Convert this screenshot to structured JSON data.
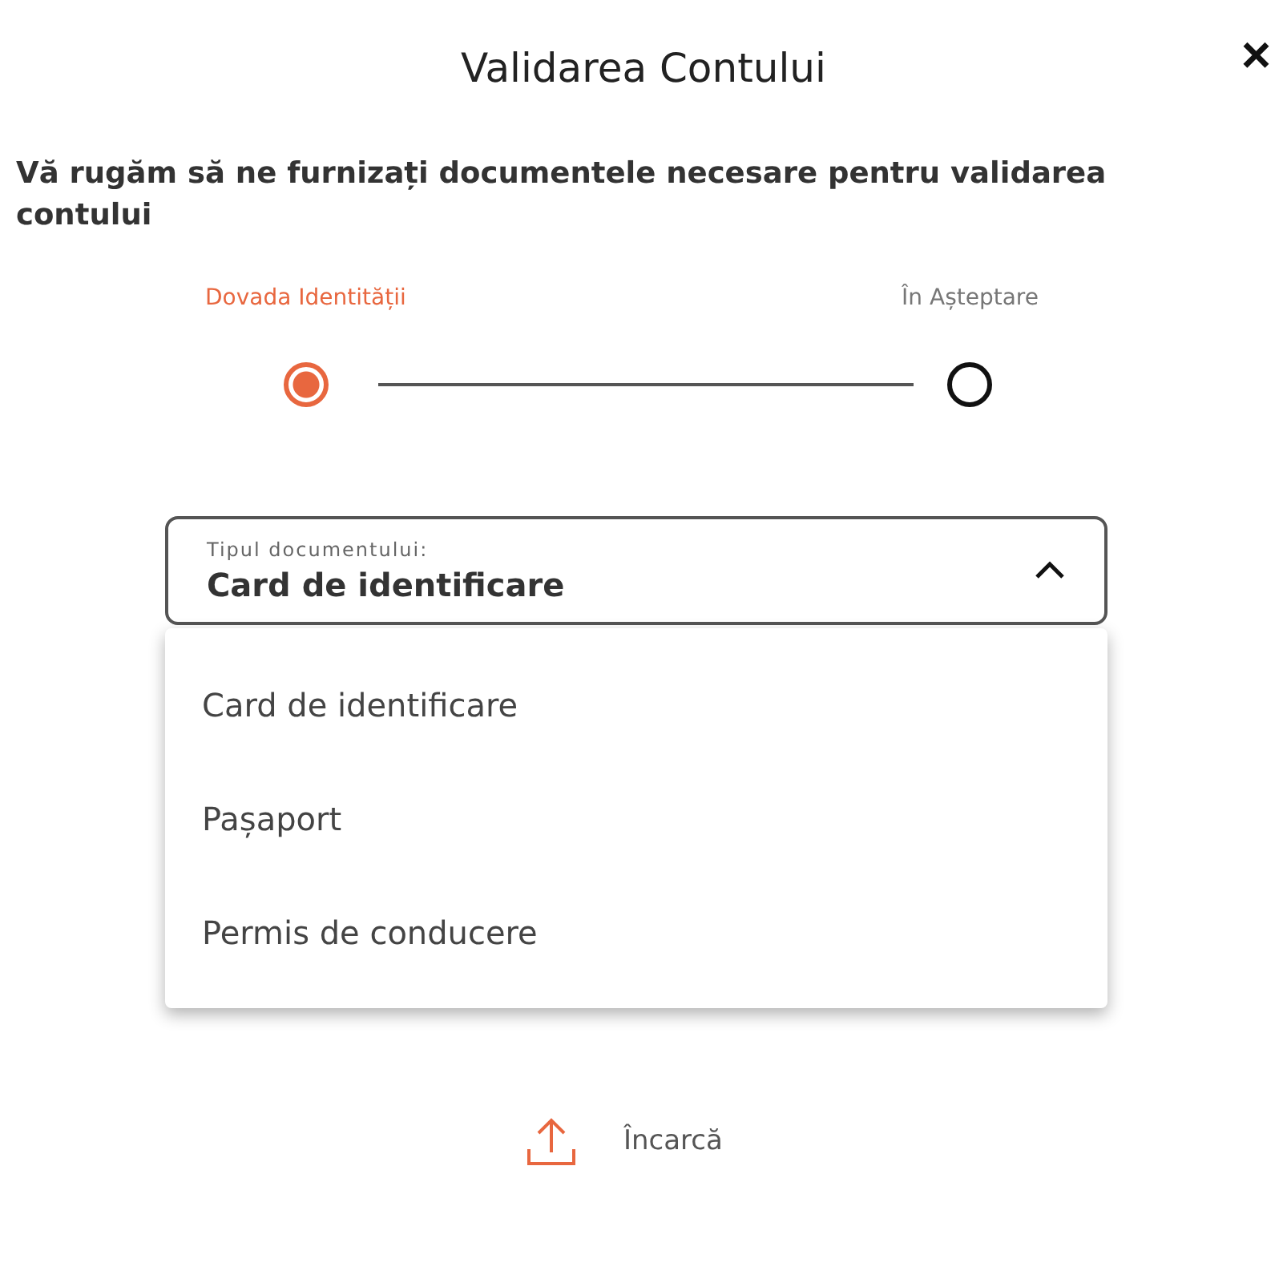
{
  "dialog": {
    "title": "Validarea Contului",
    "close": "×"
  },
  "intro": "Vă rugăm să ne furnizați documentele necesare pentru validarea contului",
  "steps": [
    {
      "label": "Dovada Identității",
      "selected": true
    },
    {
      "label": "În Așteptare",
      "selected": false
    }
  ],
  "document_type": {
    "label": "Tipul documentului:",
    "value": "Card de identificare",
    "expanded": true,
    "options": [
      "Card de identificare",
      "Pașaport",
      "Permis de conducere"
    ]
  },
  "upload": {
    "label": "Încarcă"
  }
}
